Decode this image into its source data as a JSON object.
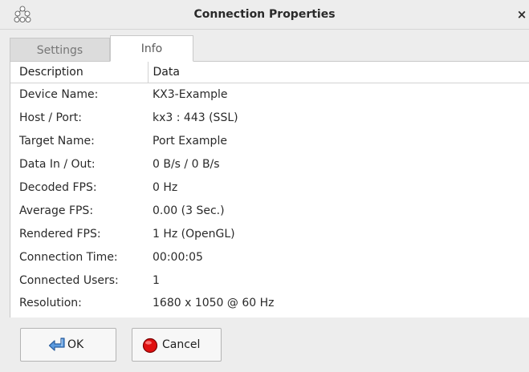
{
  "window": {
    "title": "Connection Properties",
    "close_glyph": "×",
    "app_icon": "network-nodes-icon"
  },
  "tabs": [
    {
      "label": "Settings",
      "selected": false
    },
    {
      "label": "Info",
      "selected": true
    }
  ],
  "table": {
    "headers": [
      "Description",
      "Data"
    ],
    "rows": [
      {
        "key": "Device Name:",
        "value": "KX3-Example"
      },
      {
        "key": "Host / Port:",
        "value": "kx3 : 443 (SSL)"
      },
      {
        "key": "Target Name:",
        "value": "Port Example"
      },
      {
        "key": "Data In / Out:",
        "value": "0 B/s / 0 B/s"
      },
      {
        "key": "Decoded FPS:",
        "value": "0 Hz"
      },
      {
        "key": "Average FPS:",
        "value": "0.00 (3 Sec.)"
      },
      {
        "key": "Rendered FPS:",
        "value": "1 Hz (OpenGL)"
      },
      {
        "key": "Connection Time:",
        "value": "00:00:05"
      },
      {
        "key": "Connected Users:",
        "value": "1"
      },
      {
        "key": "Resolution:",
        "value": "1680 x 1050 @ 60 Hz"
      }
    ]
  },
  "buttons": {
    "ok_label": "OK",
    "ok_icon": "enter-arrow-icon",
    "cancel_label": "Cancel",
    "cancel_icon": "red-stop-icon"
  },
  "colors": {
    "window_bg": "#ededed",
    "panel_bg": "#ffffff",
    "ok_icon_blue": "#3a7fd0",
    "cancel_icon_red": "#e01010"
  }
}
